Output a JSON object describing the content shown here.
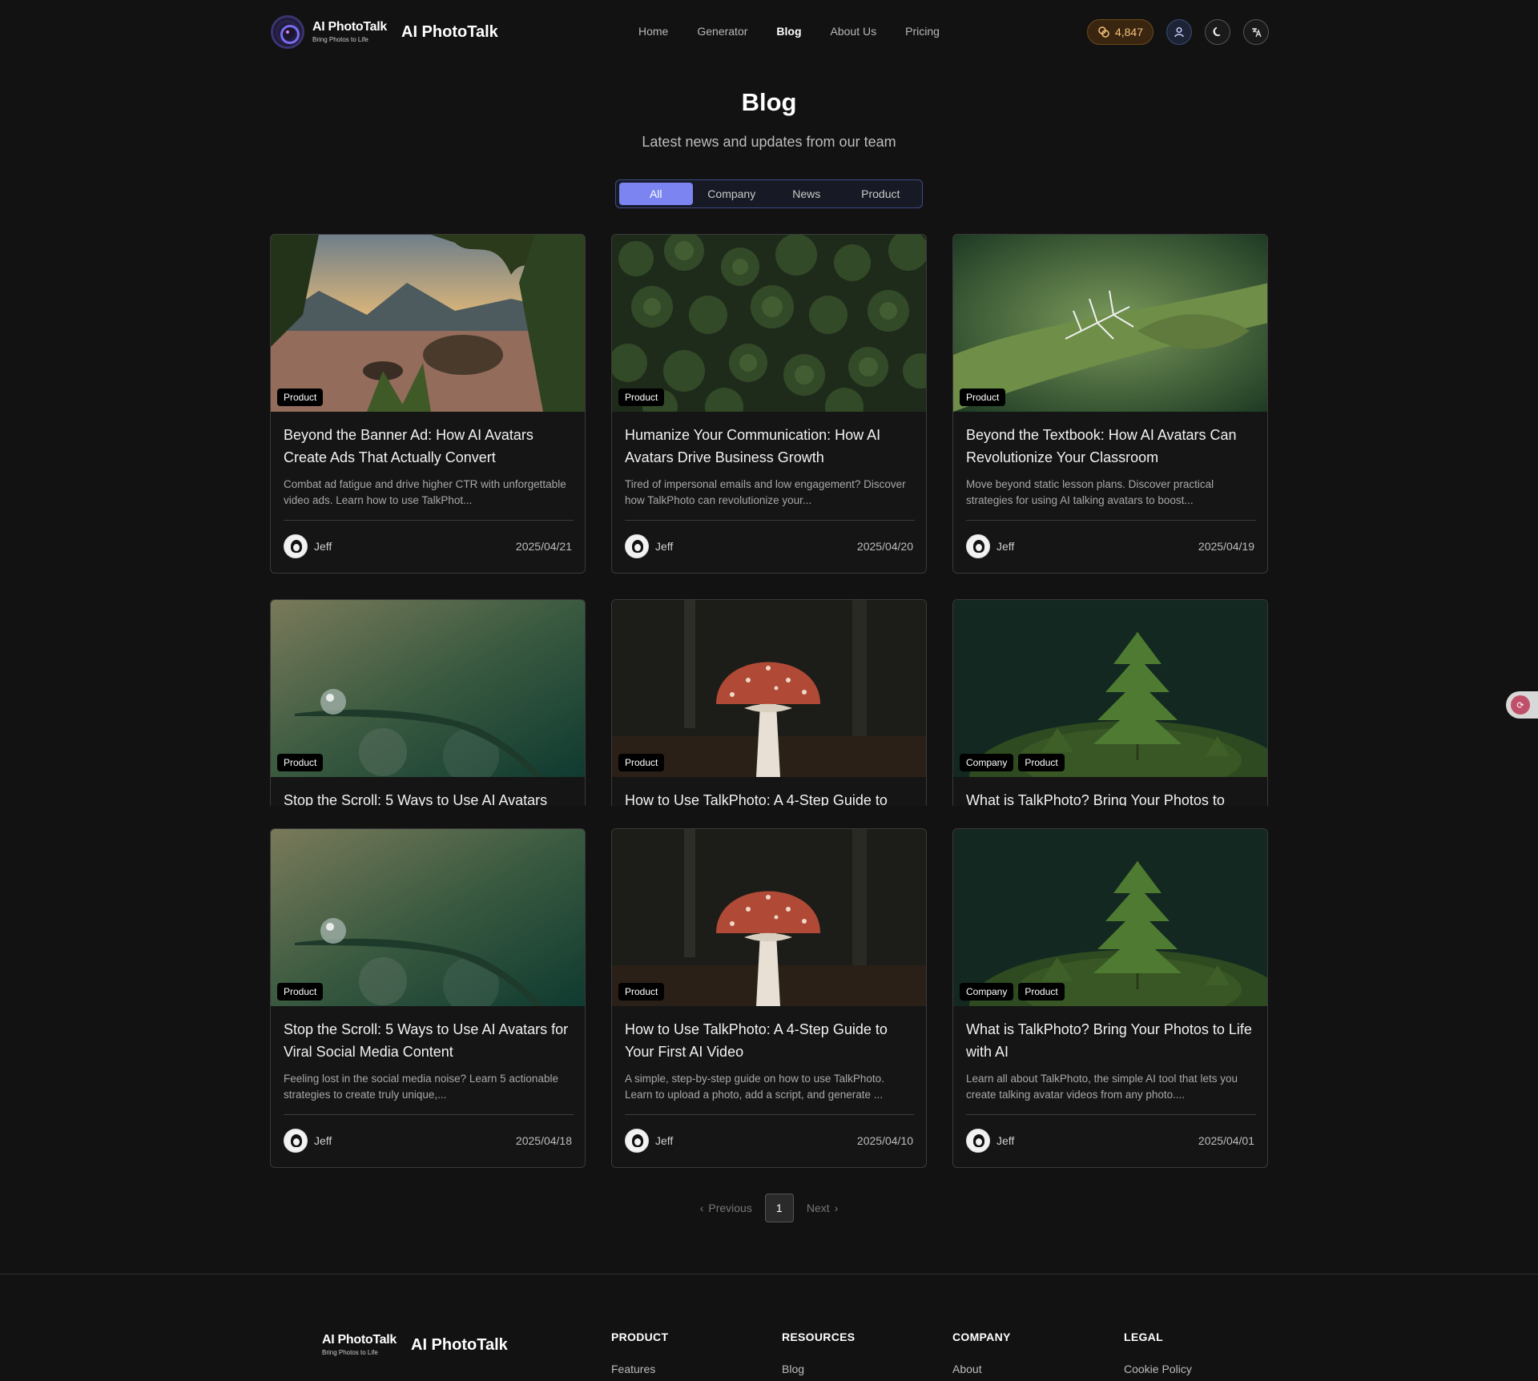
{
  "header": {
    "wordmark": "AI PhotoTalk",
    "wordmark_tagline": "Bring Photos to Life",
    "brand_name": "AI PhotoTalk",
    "nav": [
      {
        "label": "Home"
      },
      {
        "label": "Generator"
      },
      {
        "label": "Blog"
      },
      {
        "label": "About Us"
      },
      {
        "label": "Pricing"
      }
    ],
    "active_nav": "Blog",
    "credits": "4,847",
    "colors": {
      "accent": "#7b84f0",
      "credits_text": "#f3c27a",
      "background": "#121212"
    }
  },
  "page": {
    "title": "Blog",
    "subtitle": "Latest news and updates from our team"
  },
  "filters": {
    "options": [
      "All",
      "Company",
      "News",
      "Product"
    ],
    "selected": "All"
  },
  "posts": [
    {
      "tags": [
        "Product"
      ],
      "title": "Beyond the Banner Ad: How AI Avatars Create Ads That Actually Convert",
      "excerpt": "Combat ad fatigue and drive higher CTR with unforgettable video ads. Learn how to use TalkPhot...",
      "author": "Jeff",
      "date": "2025/04/21",
      "image": "lake-forest-sunset"
    },
    {
      "tags": [
        "Product"
      ],
      "title": "Humanize Your Communication: How AI Avatars Drive Business Growth",
      "excerpt": "Tired of impersonal emails and low engagement? Discover how TalkPhoto can revolutionize your...",
      "author": "Jeff",
      "date": "2025/04/20",
      "image": "aerial-pine-forest"
    },
    {
      "tags": [
        "Product"
      ],
      "title": "Beyond the Textbook: How AI Avatars Can Revolutionize Your Classroom",
      "excerpt": "Move beyond static lesson plans. Discover practical strategies for using AI talking avatars to boost...",
      "author": "Jeff",
      "date": "2025/04/19",
      "image": "frost-on-leaf"
    },
    {
      "tags": [
        "Product"
      ],
      "title": "Stop the Scroll: 5 Ways to Use AI Avatars",
      "image": "dew-drop-grass"
    },
    {
      "tags": [
        "Product"
      ],
      "title": "How to Use TalkPhoto: A 4-Step Guide to",
      "image": "red-mushroom"
    },
    {
      "tags": [
        "Company",
        "Product"
      ],
      "title": "What is TalkPhoto? Bring Your Photos to",
      "image": "moss-sapling"
    },
    {
      "tags": [
        "Product"
      ],
      "title": "Stop the Scroll: 5 Ways to Use AI Avatars for Viral Social Media Content",
      "excerpt": "Feeling lost in the social media noise? Learn 5 actionable strategies to create truly unique,...",
      "author": "Jeff",
      "date": "2025/04/18",
      "image": "dew-drop-grass"
    },
    {
      "tags": [
        "Product"
      ],
      "title": "How to Use TalkPhoto: A 4-Step Guide to Your First AI Video",
      "excerpt": "A simple, step-by-step guide on how to use TalkPhoto. Learn to upload a photo, add a script, and generate ...",
      "author": "Jeff",
      "date": "2025/04/10",
      "image": "red-mushroom"
    },
    {
      "tags": [
        "Company",
        "Product"
      ],
      "title": "What is TalkPhoto? Bring Your Photos to Life with AI",
      "excerpt": "Learn all about TalkPhoto, the simple AI tool that lets you create talking avatar videos from any photo....",
      "author": "Jeff",
      "date": "2025/04/01",
      "image": "moss-sapling"
    }
  ],
  "pagination": {
    "previous": "Previous",
    "current": "1",
    "next": "Next"
  },
  "footer": {
    "wordmark": "AI PhotoTalk",
    "wordmark_tagline": "Bring Photos to Life",
    "brand_name": "AI PhotoTalk",
    "columns": [
      {
        "heading": "PRODUCT",
        "links": [
          "Features"
        ]
      },
      {
        "heading": "RESOURCES",
        "links": [
          "Blog"
        ]
      },
      {
        "heading": "COMPANY",
        "links": [
          "About"
        ]
      },
      {
        "heading": "LEGAL",
        "links": [
          "Cookie Policy"
        ]
      }
    ]
  }
}
